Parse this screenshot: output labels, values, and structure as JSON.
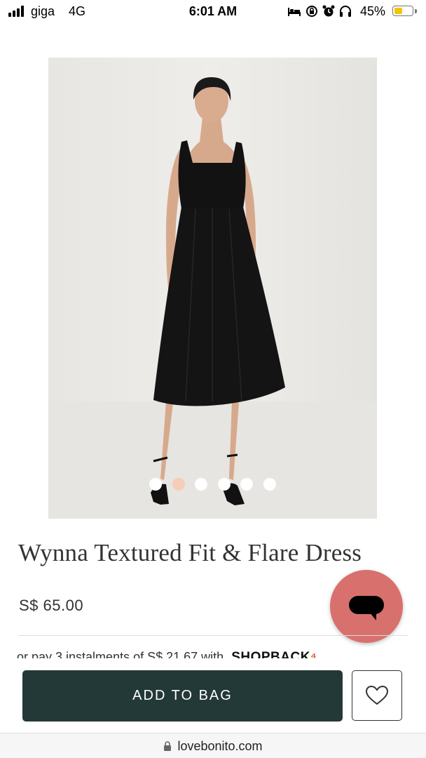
{
  "status_bar": {
    "carrier": "giga",
    "network": "4G",
    "time": "6:01 AM",
    "battery_percent": "45%",
    "battery_level": 0.45,
    "icons": [
      "bed-icon",
      "rotation-lock-icon",
      "alarm-icon",
      "headphones-icon"
    ]
  },
  "product": {
    "title": "Wynna Textured Fit & Flare Dress",
    "price": "S$ 65.00",
    "image_count": 6,
    "active_image": 1
  },
  "installment": {
    "text": "or pay 3 instalments of S$ 21.67 with",
    "brand": "SHOPBACK",
    "brand_mark": "⁴"
  },
  "actions": {
    "add_to_bag": "ADD TO BAG"
  },
  "browser": {
    "url": "lovebonito.com"
  },
  "colors": {
    "primary_button": "#233937",
    "chat_button": "#d8716d",
    "active_dot": "#f5cdb9"
  }
}
